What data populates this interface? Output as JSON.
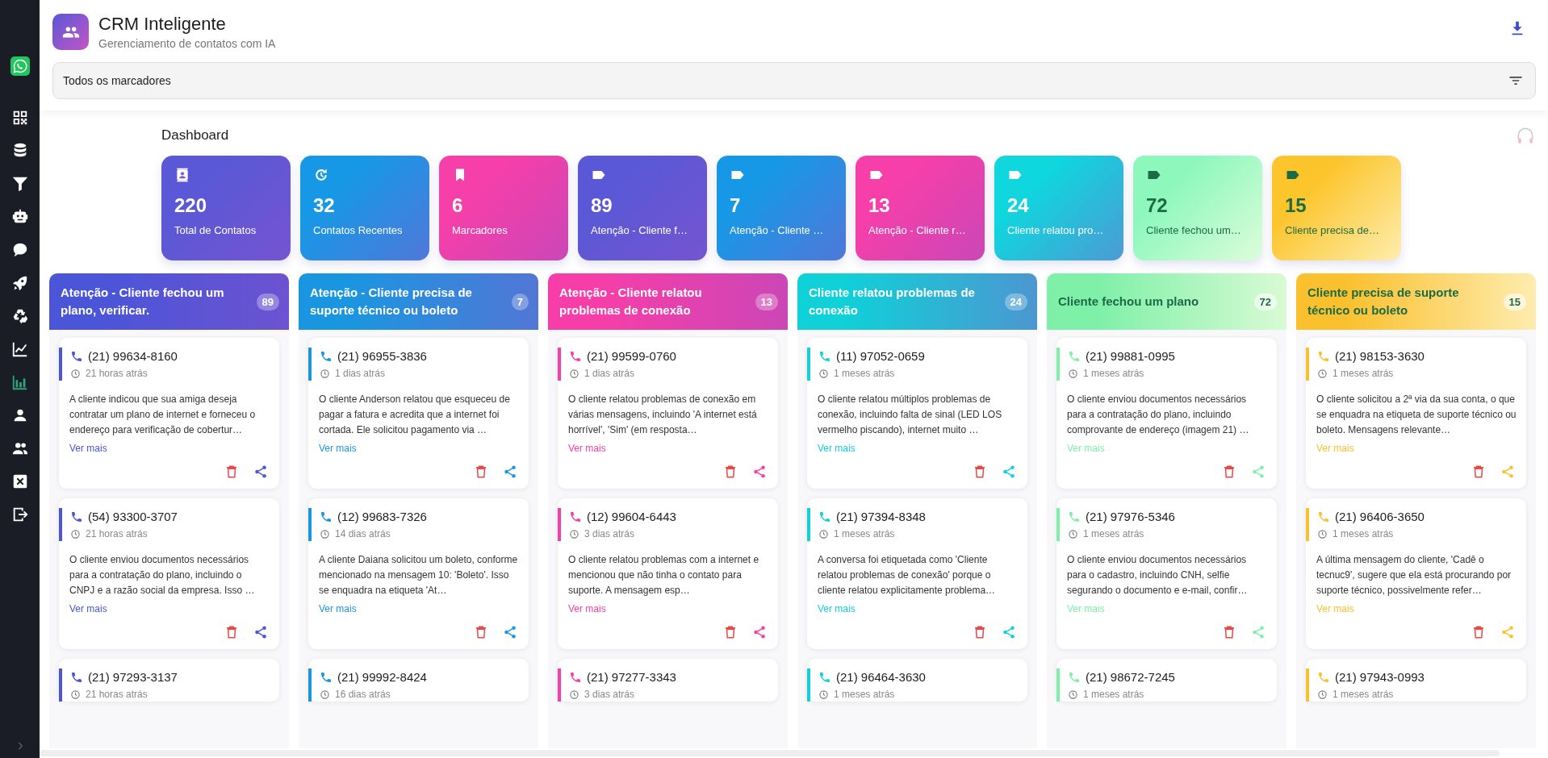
{
  "sidebar": {
    "app_icon": {
      "kind": "whatsapp"
    },
    "items": [
      {
        "kind": "qr",
        "selected": false
      },
      {
        "kind": "database",
        "selected": false
      },
      {
        "kind": "funnel",
        "selected": false
      },
      {
        "kind": "robot",
        "selected": false
      },
      {
        "kind": "chat",
        "selected": false
      },
      {
        "kind": "rocket",
        "selected": false
      },
      {
        "kind": "recycle",
        "selected": false
      },
      {
        "kind": "line-chart",
        "selected": false
      },
      {
        "kind": "bar-chart",
        "selected": true
      },
      {
        "kind": "person",
        "selected": false
      },
      {
        "kind": "people",
        "selected": false
      },
      {
        "kind": "close-box",
        "selected": false
      },
      {
        "kind": "logout",
        "selected": false
      }
    ]
  },
  "header": {
    "title": "CRM Inteligente",
    "subtitle": "Gerenciamento de contatos com IA"
  },
  "filter": {
    "value": "Todos os marcadores"
  },
  "dashboard": {
    "title": "Dashboard",
    "stats": [
      {
        "kind": "contacts",
        "value": "220",
        "label": "Total de Contatos",
        "color": "#5a58d6"
      },
      {
        "kind": "recent",
        "value": "32",
        "label": "Contatos Recentes",
        "color": "#1798e6"
      },
      {
        "kind": "markers",
        "value": "6",
        "label": "Marcadores",
        "color": "#f63fa9"
      },
      {
        "kind": "tag",
        "value": "89",
        "label": "Atenção - Cliente f…",
        "color": "#5a58d6"
      },
      {
        "kind": "tag",
        "value": "7",
        "label": "Atenção - Cliente …",
        "color": "#1798e6"
      },
      {
        "kind": "tag",
        "value": "13",
        "label": "Atenção - Cliente r…",
        "color": "#f63fa9"
      },
      {
        "kind": "tag",
        "value": "24",
        "label": "Cliente relatou pro…",
        "color": "#10d6de"
      },
      {
        "kind": "tag",
        "value": "72",
        "label": "Cliente fechou um…",
        "color": "#8ef8bc"
      },
      {
        "kind": "tag",
        "value": "15",
        "label": "Cliente precisa de…",
        "color": "#fcc52c"
      }
    ]
  },
  "columns": [
    {
      "title": "Atenção - Cliente fechou um plano, verificar.",
      "count": "89",
      "color": "#4a55d8",
      "contacts": [
        {
          "phone": "(21) 99634-8160",
          "time": "21 horas atrás",
          "summary": "A cliente indicou que sua amiga deseja contratar um plano de internet e forneceu o endereço para verificação de cobertur…",
          "link": "Ver mais"
        },
        {
          "phone": "(54) 93300-3707",
          "time": "21 horas atrás",
          "summary": "O cliente enviou documentos necessários para a contratação do plano, incluindo o CNPJ e a razão social da empresa. Isso …",
          "link": "Ver mais"
        },
        {
          "phone": "(21) 97293-3137",
          "time": "21 horas atrás"
        }
      ]
    },
    {
      "title": "Atenção - Cliente precisa de suporte técnico ou boleto",
      "count": "7",
      "color": "#1a96e0",
      "contacts": [
        {
          "phone": "(21) 96955-3836",
          "time": "1 dias atrás",
          "summary": "O cliente Anderson relatou que esqueceu de pagar a fatura e acredita que a internet foi cortada. Ele solicitou pagamento via …",
          "link": "Ver mais"
        },
        {
          "phone": "(12) 99683-7326",
          "time": "14 dias atrás",
          "summary": "A cliente Daiana solicitou um boleto, conforme mencionado na mensagem 10: 'Boleto'. Isso se enquadra na etiqueta 'At…",
          "link": "Ver mais"
        },
        {
          "phone": "(21) 99992-8424",
          "time": "16 dias atrás"
        }
      ]
    },
    {
      "title": "Atenção - Cliente relatou problemas de conexão",
      "count": "13",
      "color": "#f73ea8",
      "contacts": [
        {
          "phone": "(21) 99599-0760",
          "time": "1 dias atrás",
          "summary": "O cliente relatou problemas de conexão em várias mensagens, incluindo 'A internet está horrível', 'Sim' (em resposta…",
          "link": "Ver mais"
        },
        {
          "phone": "(12) 99604-6443",
          "time": "3 dias atrás",
          "summary": "O cliente relatou problemas com a internet e mencionou que não tinha o contato para suporte. A mensagem esp…",
          "link": "Ver mais"
        },
        {
          "phone": "(21) 97277-3343",
          "time": "3 dias atrás"
        }
      ]
    },
    {
      "title": "Cliente relatou problemas de conexão",
      "count": "24",
      "color": "#10d0d8",
      "contacts": [
        {
          "phone": "(11) 97052-0659",
          "time": "1 meses atrás",
          "summary": "O cliente relatou múltiplos problemas de conexão, incluindo falta de sinal (LED LOS vermelho piscando), internet muito …",
          "link": "Ver mais"
        },
        {
          "phone": "(21) 97394-8348",
          "time": "1 meses atrás",
          "summary": "A conversa foi etiquetada como 'Cliente relatou problemas de conexão' porque o cliente relatou explicitamente problema…",
          "link": "Ver mais"
        },
        {
          "phone": "(21) 96464-3630",
          "time": "1 meses atrás"
        }
      ]
    },
    {
      "title": "Cliente fechou um plano",
      "count": "72",
      "color": "#7ef0a8",
      "contacts": [
        {
          "phone": "(21) 99881-0995",
          "time": "1 meses atrás",
          "summary": "O cliente enviou documentos necessários para a contratação do plano, incluindo comprovante de endereço (imagem 21) …",
          "link": "Ver mais"
        },
        {
          "phone": "(21) 97976-5346",
          "time": "1 meses atrás",
          "summary": "O cliente enviou documentos necessários para o cadastro, incluindo CNH, selfie segurando o documento e e-mail, confir…",
          "link": "Ver mais"
        },
        {
          "phone": "(21) 98672-7245",
          "time": "1 meses atrás"
        }
      ]
    },
    {
      "title": "Cliente precisa de suporte técnico ou boleto",
      "count": "15",
      "color": "#fbc02d",
      "contacts": [
        {
          "phone": "(21) 98153-3630",
          "time": "1 meses atrás",
          "summary": "O cliente solicitou a 2ª via da sua conta, o que se enquadra na etiqueta de suporte técnico ou boleto. Mensagens relevante…",
          "link": "Ver mais"
        },
        {
          "phone": "(21) 96406-3650",
          "time": "1 meses atrás",
          "summary": "A última mensagem do cliente, 'Cadê o tecnuc9', sugere que ela está procurando por suporte técnico, possivelmente refer…",
          "link": "Ver mais"
        },
        {
          "phone": "(21) 97943-0993",
          "time": "1 meses atrás"
        }
      ]
    }
  ]
}
